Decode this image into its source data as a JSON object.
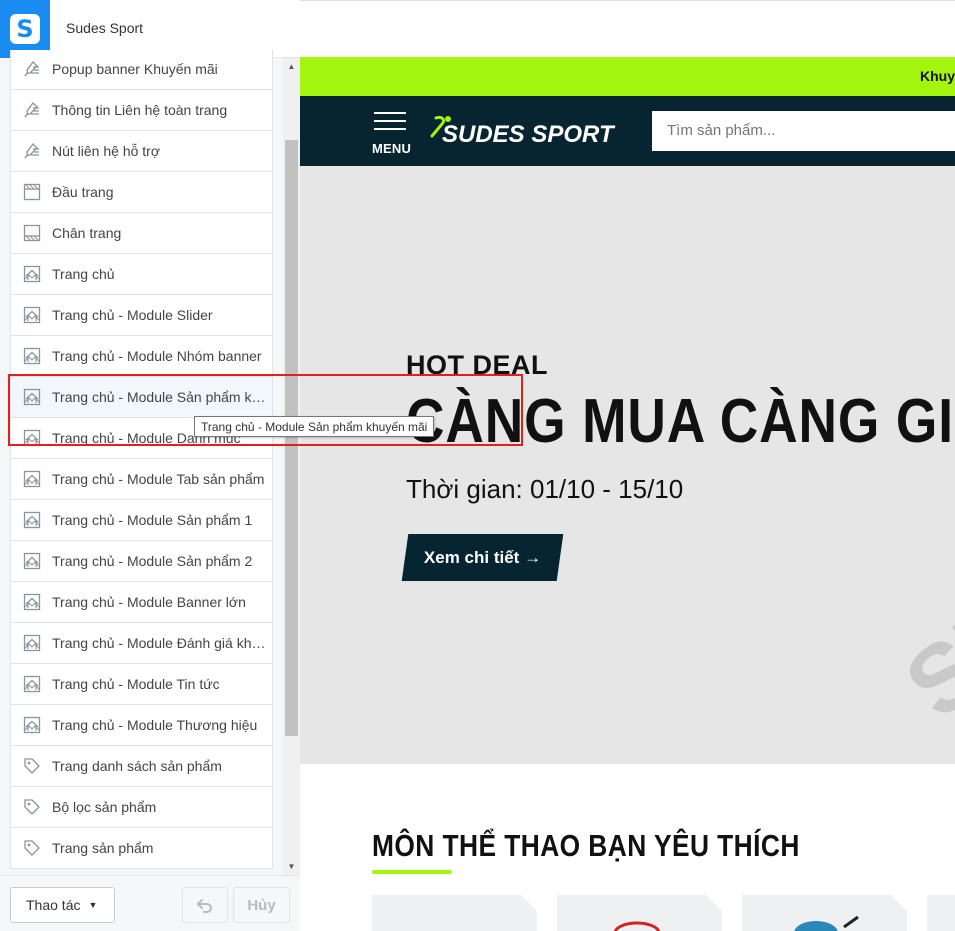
{
  "sidebar": {
    "shop_name": "Sudes Sport",
    "logo_letter": "S",
    "items": [
      {
        "label": "Popup banner Khuyến mãi",
        "icon": "paint-brush-icon"
      },
      {
        "label": "Thông tin Liên hệ toàn trang",
        "icon": "paint-brush-icon"
      },
      {
        "label": "Nút liên hệ hỗ trợ",
        "icon": "paint-brush-icon"
      },
      {
        "label": "Đầu trang",
        "icon": "page-header-icon"
      },
      {
        "label": "Chân trang",
        "icon": "page-footer-icon"
      },
      {
        "label": "Trang chủ",
        "icon": "home-page-icon"
      },
      {
        "label": "Trang chủ - Module Slider",
        "icon": "home-page-icon"
      },
      {
        "label": "Trang chủ - Module Nhóm banner",
        "icon": "home-page-icon"
      },
      {
        "label": "Trang chủ - Module Sản phẩm khuyến mãi",
        "icon": "home-page-icon"
      },
      {
        "label": "Trang chủ - Module Danh mục",
        "icon": "home-page-icon"
      },
      {
        "label": "Trang chủ - Module Tab sản phẩm",
        "icon": "home-page-icon"
      },
      {
        "label": "Trang chủ - Module Sản phẩm 1",
        "icon": "home-page-icon"
      },
      {
        "label": "Trang chủ - Module Sản phẩm 2",
        "icon": "home-page-icon"
      },
      {
        "label": "Trang chủ - Module Banner lớn",
        "icon": "home-page-icon"
      },
      {
        "label": "Trang chủ - Module Đánh giá khách hàng",
        "icon": "home-page-icon"
      },
      {
        "label": "Trang chủ - Module Tin tức",
        "icon": "home-page-icon"
      },
      {
        "label": "Trang chủ - Module Thương hiệu",
        "icon": "home-page-icon"
      },
      {
        "label": "Trang danh sách sản phẩm",
        "icon": "tag-icon"
      },
      {
        "label": "Bộ lọc sản phẩm",
        "icon": "tag-icon"
      },
      {
        "label": "Trang sản phẩm",
        "icon": "tag-icon"
      }
    ],
    "tooltip": "Trang chủ - Module Sản phẩm khuyến mãi",
    "footer": {
      "actions_label": "Thao tác",
      "cancel_label": "Hủy"
    }
  },
  "preview": {
    "promo_text": "Khuyến mãi",
    "menu_label": "MENU",
    "brand_name": "SUDES SPORT",
    "search_placeholder": "Tìm sản phẩm...",
    "hero": {
      "kicker": "HOT DEAL",
      "title": "CÀNG MUA CÀNG GIẢM",
      "time": "Thời gian: 01/10 - 15/10",
      "button_label": "Xem chi tiết",
      "watermark": "SUDES"
    },
    "section_title": "MÔN THỂ THAO BẠN YÊU THÍCH"
  },
  "colors": {
    "brand_blue": "#1a8bf0",
    "lime": "#a3f50d",
    "dark_navy": "#062530",
    "highlight_red": "#e2211c"
  }
}
